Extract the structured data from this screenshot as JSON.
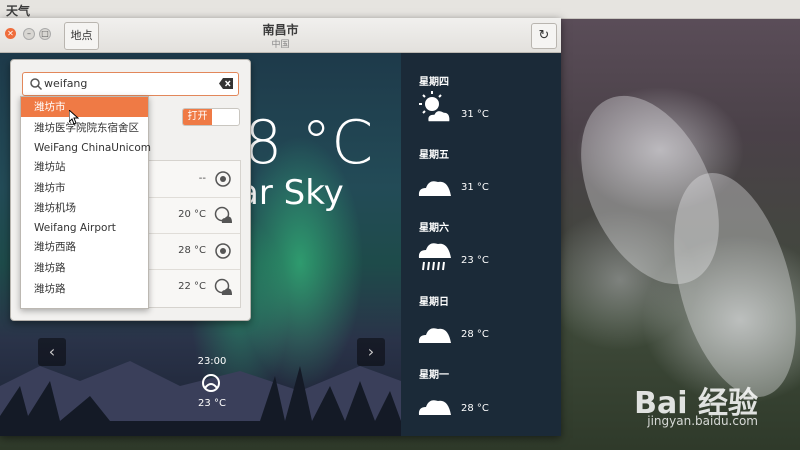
{
  "topbar": {
    "title": "天气"
  },
  "window": {
    "places_button": "地点",
    "city": "南昌市",
    "country": "中国",
    "refresh_icon": "refresh-icon",
    "current": {
      "temp": "8 °C",
      "condition": "ar Sky"
    },
    "hourly": {
      "time": "23:00",
      "temp": "23 °C",
      "icon": "clear-night-icon"
    },
    "forecast": [
      {
        "day": "星期四",
        "temp": "31 °C",
        "icon": "partly-cloudy-icon"
      },
      {
        "day": "星期五",
        "temp": "31 °C",
        "icon": "cloud-icon"
      },
      {
        "day": "星期六",
        "temp": "23 °C",
        "icon": "rain-icon"
      },
      {
        "day": "星期日",
        "temp": "28 °C",
        "icon": "cloud-icon"
      },
      {
        "day": "星期一",
        "temp": "28 °C",
        "icon": "cloud-icon"
      }
    ]
  },
  "popover": {
    "search_value": "weifang",
    "toggle_label": "打开",
    "locations": [
      {
        "temp": "--",
        "icon": "clear-night-icon"
      },
      {
        "temp": "20 °C",
        "icon": "clear-night-cloud-icon"
      },
      {
        "temp": "28 °C",
        "icon": "clear-night-icon"
      },
      {
        "temp": "22 °C",
        "icon": "clear-night-cloud-icon"
      }
    ]
  },
  "dropdown": {
    "items": [
      "潍坊市",
      "潍坊医学院院东宿舍区",
      "WeiFang ChinaUnicom",
      "潍坊站",
      "潍坊市",
      "潍坊机场",
      "Weifang Airport",
      "潍坊西路",
      "潍坊路",
      "潍坊路"
    ],
    "selected_index": 0
  },
  "watermark": {
    "brand": "Bai 经验",
    "url": "jingyan.baidu.com"
  },
  "colors": {
    "accent": "#ef7a45",
    "headerbar": "#e8e6e2",
    "forecast_bg": "#1b2a38"
  }
}
